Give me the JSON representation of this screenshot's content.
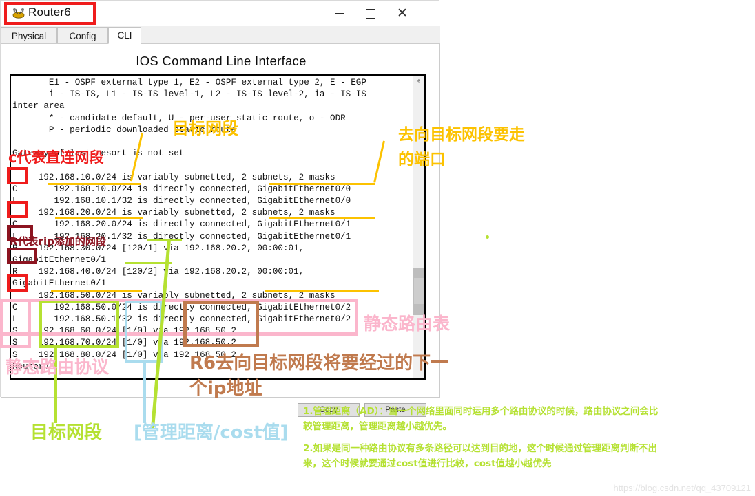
{
  "window": {
    "title": "Router6",
    "icon": "router-icon",
    "minimize_label": "–",
    "maximize_label": "□",
    "close_label": "✕"
  },
  "tabs": [
    {
      "label": "Physical",
      "active": false
    },
    {
      "label": "Config",
      "active": false
    },
    {
      "label": "CLI",
      "active": true
    }
  ],
  "cli": {
    "heading": "IOS Command Line Interface",
    "copy_label": "Copy",
    "paste_label": "Paste",
    "scroll_up_icon": "ⱏ",
    "scroll_down_icon": "ⱟ",
    "terminal_lines": [
      "       E1 - OSPF external type 1, E2 - OSPF external type 2, E - EGP",
      "       i - IS-IS, L1 - IS-IS level-1, L2 - IS-IS level-2, ia - IS-IS",
      "inter area",
      "       * - candidate default, U - per-user static route, o - ODR",
      "       P - periodic downloaded static route",
      "",
      "Gateway of last resort is not set",
      "",
      "     192.168.10.0/24 is variably subnetted, 2 subnets, 2 masks",
      "C       192.168.10.0/24 is directly connected, GigabitEthernet0/0",
      "L       192.168.10.1/32 is directly connected, GigabitEthernet0/0",
      "     192.168.20.0/24 is variably subnetted, 2 subnets, 2 masks",
      "C       192.168.20.0/24 is directly connected, GigabitEthernet0/1",
      "L       192.168.20.1/32 is directly connected, GigabitEthernet0/1",
      "R    192.168.30.0/24 [120/1] via 192.168.20.2, 00:00:01,",
      "GigabitEthernet0/1",
      "R    192.168.40.0/24 [120/2] via 192.168.20.2, 00:00:01,",
      "GigabitEthernet0/1",
      "     192.168.50.0/24 is variably subnetted, 2 subnets, 2 masks",
      "C       192.168.50.0/24 is directly connected, GigabitEthernet0/2",
      "L       192.168.50.1/32 is directly connected, GigabitEthernet0/2",
      "S    192.168.60.0/24 [1/0] via 192.168.50.2",
      "S    192.168.70.0/24 [1/0] via 192.168.50.2",
      "S    192.168.80.0/24 [1/0] via 192.168.50.2",
      "Router#",
      "        "
    ]
  },
  "annotations": {
    "c_direct": "c代表直连网段",
    "r_rip": "R代表rip添加的网段",
    "target_net_yellow": "目标网段",
    "egress_port_line1": "去向目标网段要走",
    "egress_port_line2": "的端口",
    "static_route_table": "静态路由表",
    "static_route_protocol": "静态路由协议",
    "target_net_green": "目标网段",
    "ad_cost": "[管理距离/cost值]",
    "next_hop_line1": "R6去向目标网段将要经过的下一",
    "next_hop_line2": "个ip地址",
    "note1": "1.管理距离（AD）：当一个网络里面同时运用多个路由协议的时候，路由协议之间会比",
    "note1b": "较管理距离，管理距离越小越优先。",
    "note2": "2.如果是同一种路由协议有多条路径可以达到目的地，这个时候通过管理距离判断不出",
    "note2b": "来，这个时候就要通过cost值进行比较，cost值越小越优先"
  },
  "watermark": "https://blog.csdn.net/qq_43709121",
  "colors": {
    "red": "#ef1c1c",
    "dark_red": "#8c1420",
    "yellow": "#fcc200",
    "green": "#b5e132",
    "pink": "#fbb6cc",
    "light_blue": "#aadcee",
    "brown": "#c07a4e",
    "watermark_gray": "#e3e3e3"
  }
}
